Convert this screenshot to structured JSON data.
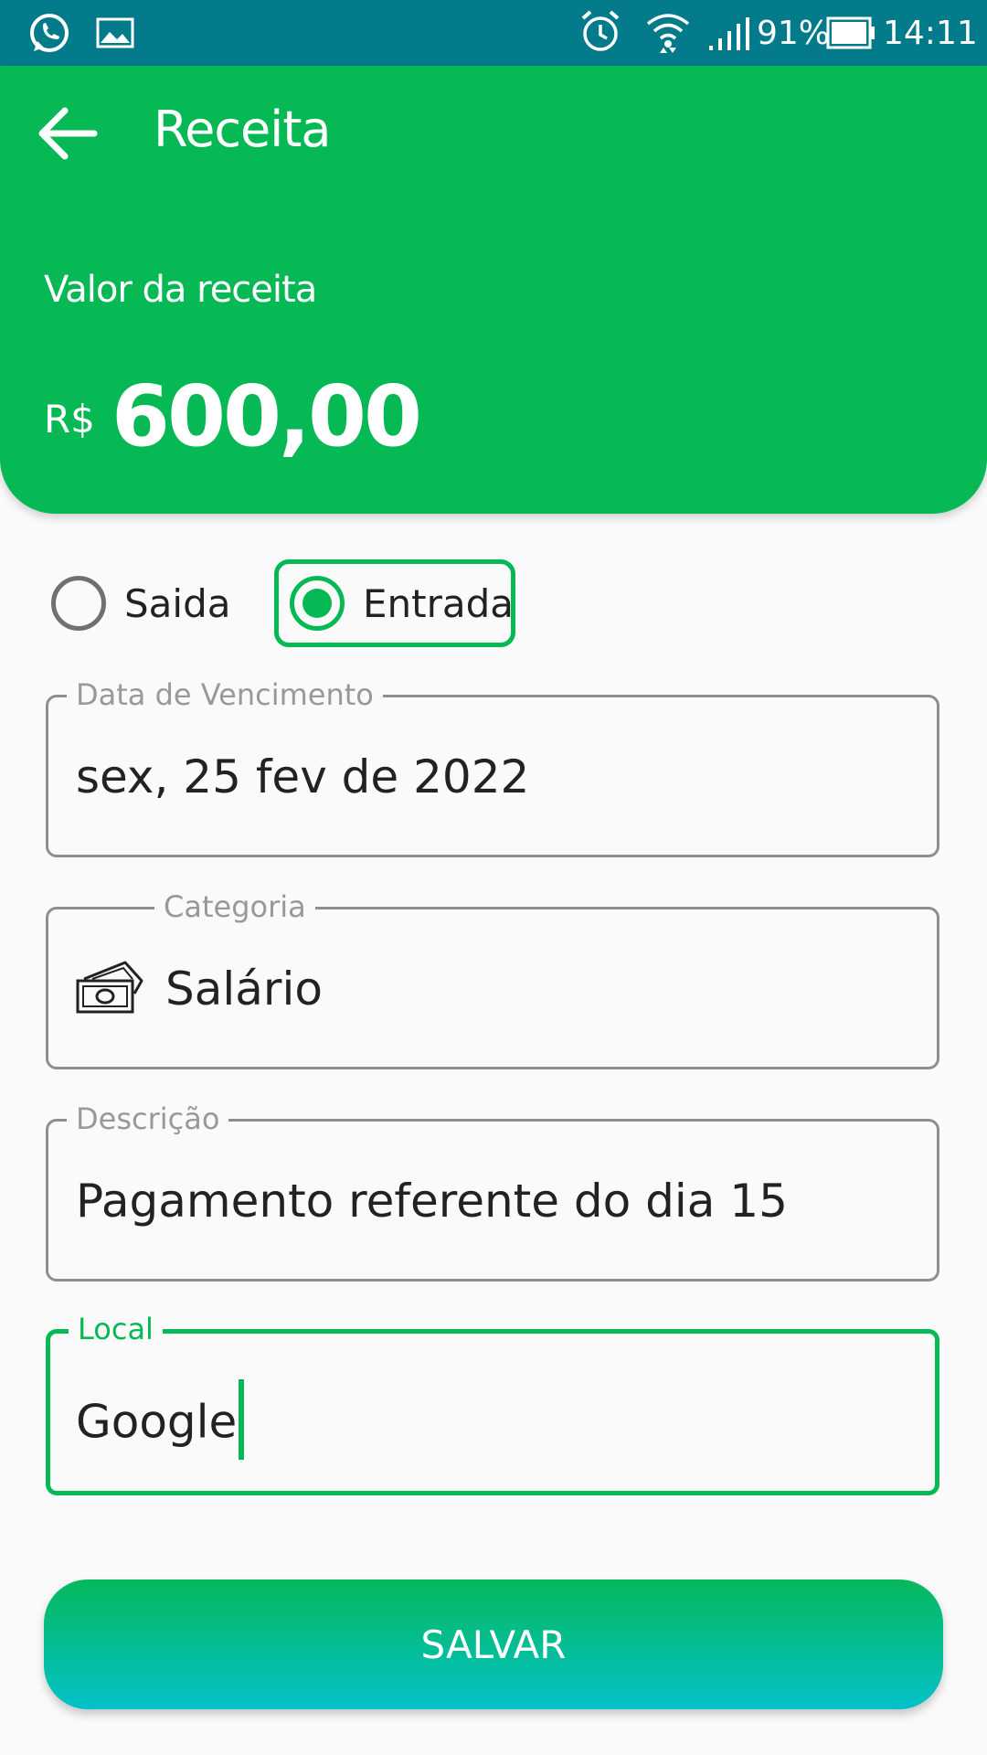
{
  "status_bar": {
    "battery": "91%",
    "time": "14:11",
    "icons": [
      "whatsapp-icon",
      "gallery-icon",
      "alarm-icon",
      "wifi-icon",
      "signal-icon",
      "battery-icon"
    ]
  },
  "header": {
    "title": "Receita",
    "amount_label": "Valor da receita",
    "currency": "R$",
    "amount": "600,00",
    "color": "#06b955"
  },
  "type_selector": {
    "options": [
      {
        "label": "Saida",
        "selected": false
      },
      {
        "label": "Entrada",
        "selected": true
      }
    ]
  },
  "form": {
    "due_date": {
      "label": "Data de Vencimento",
      "value": "sex, 25 fev de 2022"
    },
    "category": {
      "label": "Categoria",
      "value": "Salário",
      "icon": "money-bills-icon"
    },
    "description": {
      "label": "Descrição",
      "value": "Pagamento referente do dia 15"
    },
    "location": {
      "label": "Local",
      "value": "Google",
      "focused": true
    }
  },
  "actions": {
    "save_label": "SALVAR"
  }
}
